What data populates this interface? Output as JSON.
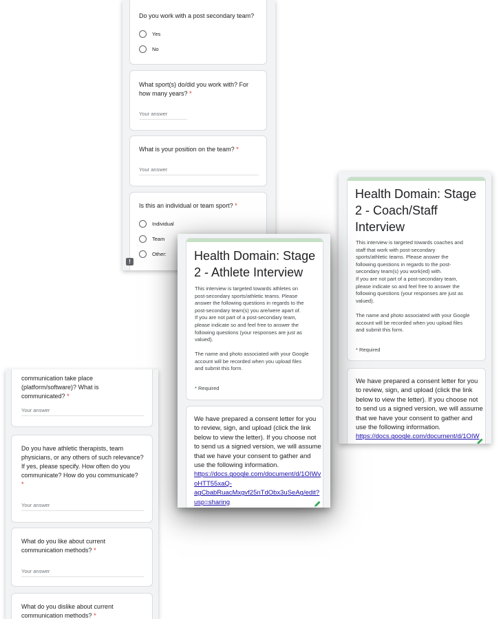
{
  "topform": {
    "q1": {
      "text": "Do you work with a post secondary team?",
      "options": [
        "Yes",
        "No"
      ]
    },
    "q2": {
      "text_l1": "What sport(s) do/did you work with? For",
      "text_l2": "how many years?",
      "req": "*",
      "placeholder": "Your answer"
    },
    "q3": {
      "text": "What is your position on the team?",
      "req": "*",
      "placeholder": "Your answer"
    },
    "q4": {
      "text": "Is this an individual or team sport?",
      "req": "*",
      "options": [
        "Individual",
        "Team",
        "Other:"
      ]
    },
    "feedback_badge": "!"
  },
  "athlete": {
    "title_l1": "Health Domain: Stage",
    "title_l2": "2 - Athlete Interview",
    "desc_l1": "This interview is targeted towards athletes on",
    "desc_l2": "post-secondary sports/athletic teams. Please",
    "desc_l3": "answer the following questions in regards to the",
    "desc_l4": "post-secondary team(s) you are/were apart of.",
    "desc_l5": "If you are not part of a post-secondary team,",
    "desc_l6": "please indicate so and feel free to answer the",
    "desc_l7": "following questions (your responses are just as",
    "desc_l8": "valued).",
    "notice_l1": "The name and photo associated with your Google",
    "notice_l2": "account will be recorded when you upload files",
    "notice_l3": "and submit this form.",
    "required": "* Required",
    "consent_l1": "We have prepared a consent letter for you",
    "consent_l2": "to review, sign, and upload (click the link",
    "consent_l3": "below to view the letter). If you choose not",
    "consent_l4": "to send us a signed version, we will assume",
    "consent_l5": "that we have your consent to gather and",
    "consent_l6": "use the following information.",
    "link_l1": "https://docs.google.com/document/d/1OIWv",
    "link_l2": "oHTT55xaQ-",
    "link_l3": "agCbabRuacMxgvf25nTdObx3uSeAg/edit?",
    "link_l4": "usp=sharing"
  },
  "coach": {
    "title_l1": "Health Domain: Stage",
    "title_l2": "2 - Coach/Staff",
    "title_l3": "Interview",
    "desc_l1": "This interview is targeted towards coaches and",
    "desc_l2": "staff that work with post-secondary",
    "desc_l3": "sports/athletic teams. Please answer the",
    "desc_l4": "following questions in regards to the post-",
    "desc_l5": "secondary team(s) you work(ed) with.",
    "desc_l6": "If you are not part of a post-secondary team,",
    "desc_l7": "please indicate so and feel free to answer the",
    "desc_l8": "following questions (your responses are just as",
    "desc_l9": "valued).",
    "notice_l1": "The name and photo associated with your Google",
    "notice_l2": "account will be recorded when you upload files",
    "notice_l3": "and submit this form.",
    "required": "* Required",
    "consent_l1": "We have prepared a consent letter for you",
    "consent_l2": "to review, sign, and upload (click the link",
    "consent_l3": "below to view the letter). If you choose not",
    "consent_l4": "to send us a signed version, we will assume",
    "consent_l5": "that we have your consent to gather and",
    "consent_l6": "use the following information.",
    "link_l1": "https://docs.google.com/document/d/1OIW"
  },
  "bottomform": {
    "q1_l1": "communication take place",
    "q1_l2": "(platform/software)? What is",
    "q1_l3": "communicated?",
    "q2_l1": "Do you have athletic therapists, team",
    "q2_l2": "physicians, or any others of such relevance?",
    "q2_l3": "If yes, please specify. How often do you",
    "q2_l4": "communicate? How do you communicate?",
    "q3_l1": "What do you like about current",
    "q3_l2": "communication methods?",
    "q4_l1": "What do you dislike about current",
    "q4_l2": "communication methods?",
    "req": "*",
    "placeholder": "Your answer"
  },
  "colors": {
    "panel": "#f1f3f4",
    "accent": "#c5e1c5",
    "required": "#d93025",
    "link": "#1a0dab"
  }
}
